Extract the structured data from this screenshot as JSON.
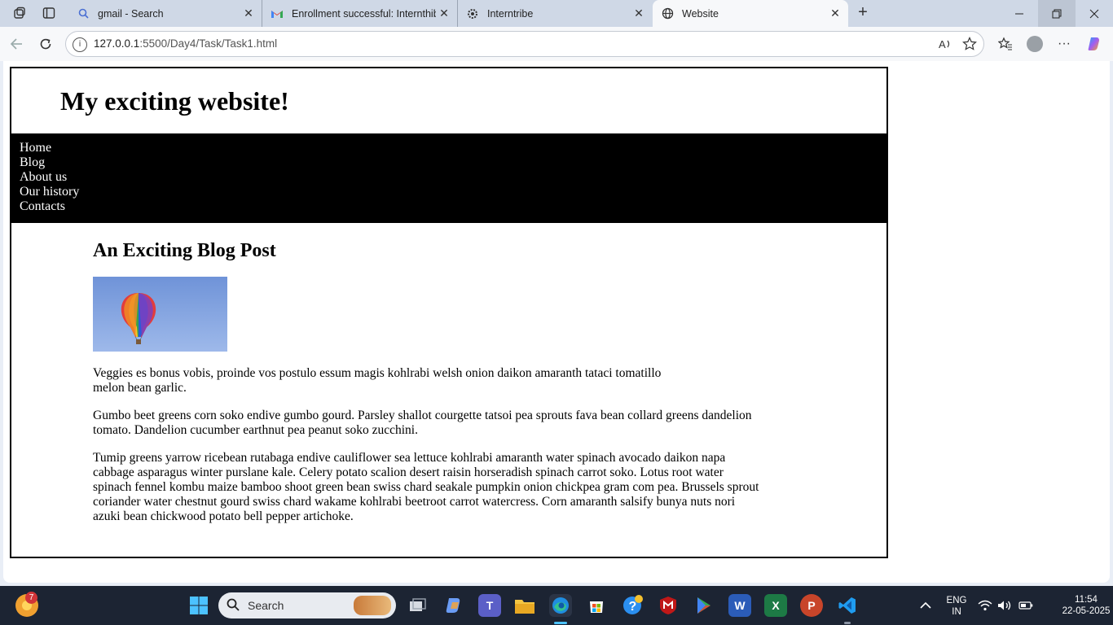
{
  "browser": {
    "tabs": [
      {
        "title": "gmail - Search",
        "icon": "search-icon",
        "active": false
      },
      {
        "title": "Enrollment successful: Internthibe",
        "icon": "gmail-icon",
        "active": false
      },
      {
        "title": "Interntribe",
        "icon": "interntribe-icon",
        "active": false
      },
      {
        "title": "Website",
        "icon": "globe-icon",
        "active": true
      }
    ],
    "address": {
      "host": "127.0.0.1",
      "path": ":5500/Day4/Task/Task1.html"
    }
  },
  "page": {
    "site_title": "My exciting website!",
    "nav": [
      "Home",
      "Blog",
      "About us",
      "Our history",
      "Contacts"
    ],
    "post": {
      "heading": "An Exciting Blog Post",
      "paragraphs": [
        "Veggies es bonus vobis, proinde vos postulo essum magis kohlrabi welsh onion daikon amaranth tataci tomatillo melon bean garlic.",
        "Gumbo beet greens corn soko endive gumbo gourd. Parsley shallot courgette tatsoi pea sprouts fava bean collard greens dandelion tomato. Dandelion cucumber earthnut pea peanut soko zucchini.",
        "Tumip greens yarrow ricebean rutabaga endive cauliflower sea lettuce kohlrabi amaranth water spinach avocado daikon napa cabbage asparagus winter purslane kale. Celery potato scalion desert raisin horseradish spinach carrot soko. Lotus root water spinach fennel kombu maize bamboo shoot green bean swiss chard seakale pumpkin onion chickpea gram com pea. Brussels sprout coriander water chestnut gourd swiss chard wakame kohlrabi beetroot carrot watercress. Corn amaranth salsify bunya nuts nori azuki bean chickwood potato bell pepper artichoke."
      ]
    }
  },
  "taskbar": {
    "search_label": "Search",
    "weather_badge": "7",
    "lang_top": "ENG",
    "lang_bottom": "IN",
    "time": "11:54",
    "date": "22-05-2025"
  }
}
